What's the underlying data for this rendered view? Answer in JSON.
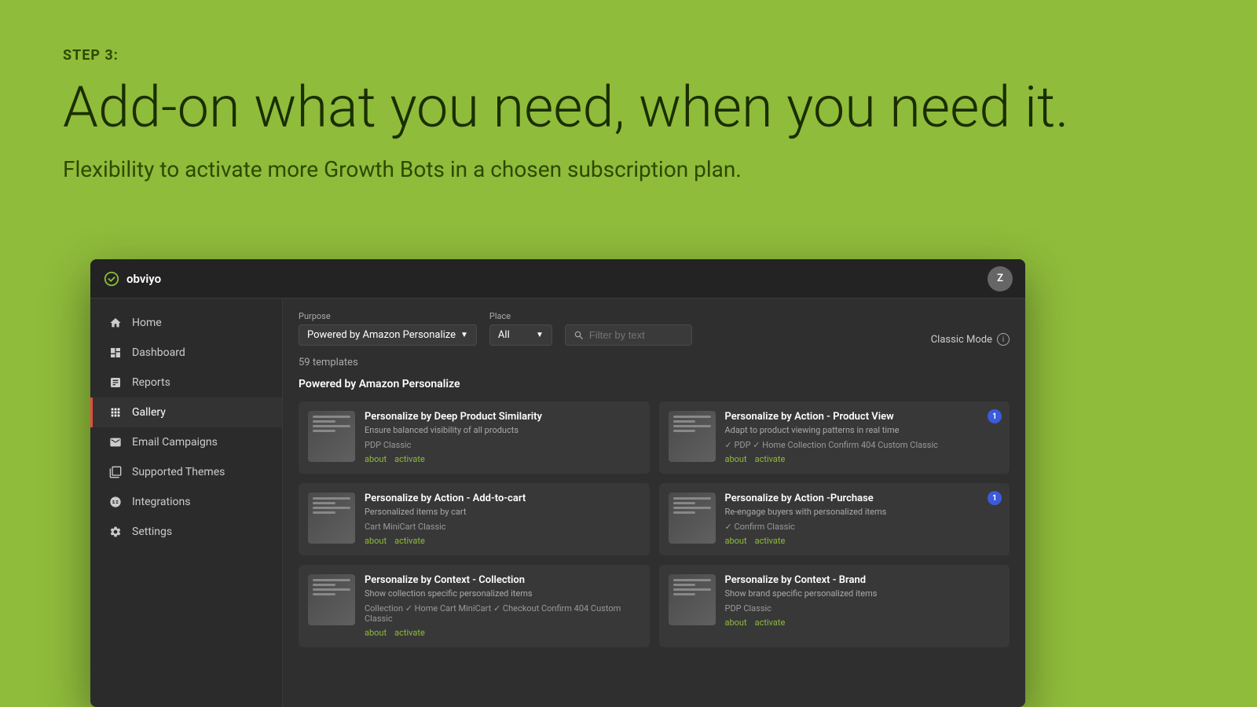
{
  "background_color": "#8fbc3b",
  "step_label": "STEP 3:",
  "main_heading": "Add-on what you need, when you need it.",
  "sub_heading": "Flexibility to activate more Growth Bots in a chosen subscription plan.",
  "app": {
    "logo_text": "obviyo",
    "user_avatar": "Z",
    "sidebar": {
      "items": [
        {
          "id": "home",
          "label": "Home",
          "icon": "home-icon",
          "active": false
        },
        {
          "id": "dashboard",
          "label": "Dashboard",
          "icon": "dashboard-icon",
          "active": false
        },
        {
          "id": "reports",
          "label": "Reports",
          "icon": "reports-icon",
          "active": false
        },
        {
          "id": "gallery",
          "label": "Gallery",
          "icon": "gallery-icon",
          "active": true
        },
        {
          "id": "email-campaigns",
          "label": "Email Campaigns",
          "icon": "email-icon",
          "active": false
        },
        {
          "id": "supported-themes",
          "label": "Supported Themes",
          "icon": "themes-icon",
          "active": false
        },
        {
          "id": "integrations",
          "label": "Integrations",
          "icon": "integrations-icon",
          "active": false
        },
        {
          "id": "settings",
          "label": "Settings",
          "icon": "settings-icon",
          "active": false
        }
      ]
    },
    "filters": {
      "purpose_label": "Purpose",
      "purpose_value": "Powered by Amazon Personalize",
      "place_label": "Place",
      "place_value": "All",
      "search_placeholder": "Filter by text",
      "classic_mode_label": "Classic Mode"
    },
    "templates_count": "59 templates",
    "section_title": "Powered by Amazon Personalize",
    "templates": [
      {
        "id": "deep-product-similarity",
        "name": "Personalize by Deep Product Similarity",
        "description": "Ensure balanced visibility of all products",
        "tags": "PDP  Classic",
        "actions": [
          "about",
          "activate"
        ],
        "badge": null
      },
      {
        "id": "action-product-view",
        "name": "Personalize by Action - Product View",
        "description": "Adapt to product viewing patterns in real time",
        "tags": "✓ PDP  ✓ Home  Collection  Confirm  404  Custom  Classic",
        "actions": [
          "about",
          "activate"
        ],
        "badge": "1"
      },
      {
        "id": "action-add-to-cart",
        "name": "Personalize by Action - Add-to-cart",
        "description": "Personalized items by cart",
        "tags": "Cart  MiniCart  Classic",
        "actions": [
          "about",
          "activate"
        ],
        "badge": null
      },
      {
        "id": "action-purchase",
        "name": "Personalize by Action -Purchase",
        "description": "Re-engage buyers with personalized items",
        "tags": "✓ Confirm  Classic",
        "actions": [
          "about",
          "activate"
        ],
        "badge": "1"
      },
      {
        "id": "context-collection",
        "name": "Personalize by Context - Collection",
        "description": "Show collection specific personalized items",
        "tags": "Collection  ✓ Home  Cart  MiniCart  ✓ Checkout  Confirm  404  Custom  Classic",
        "actions": [
          "about",
          "activate"
        ],
        "badge": null
      },
      {
        "id": "context-brand",
        "name": "Personalize by Context - Brand",
        "description": "Show brand specific personalized items",
        "tags": "PDP  Classic",
        "actions": [
          "about",
          "activate"
        ],
        "badge": null
      }
    ]
  }
}
